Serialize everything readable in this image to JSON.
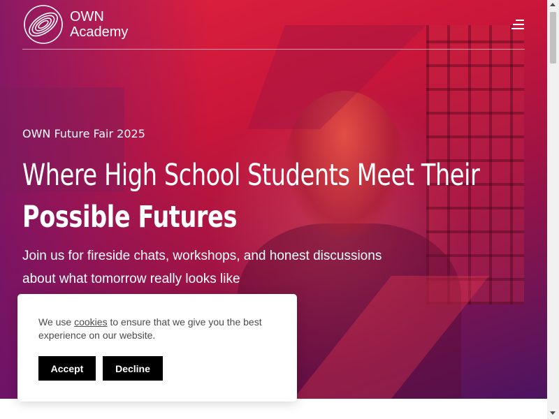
{
  "brand": {
    "logo_icon": "swirl-logo",
    "name_line1": "OWN",
    "name_line2": "Academy"
  },
  "nav": {
    "menu_icon": "hamburger-menu-icon"
  },
  "hero": {
    "eyebrow": "OWN Future Fair 2025",
    "headline_line1": "Where High School Students Meet Their",
    "headline_line2": "Possible Futures",
    "subtitle": "Join us for fireside chats, workshops, and honest discussions about what tomorrow really looks like"
  },
  "cookie_banner": {
    "text_before": "We use ",
    "link_text": "cookies",
    "text_after": " to ensure that we give you the best experience on our website.",
    "accept_label": "Accept",
    "decline_label": "Decline"
  },
  "colors": {
    "hero_red": "#e4233f",
    "hero_purple": "#4b1460",
    "button_bg": "#000000",
    "button_text": "#ffffff"
  }
}
